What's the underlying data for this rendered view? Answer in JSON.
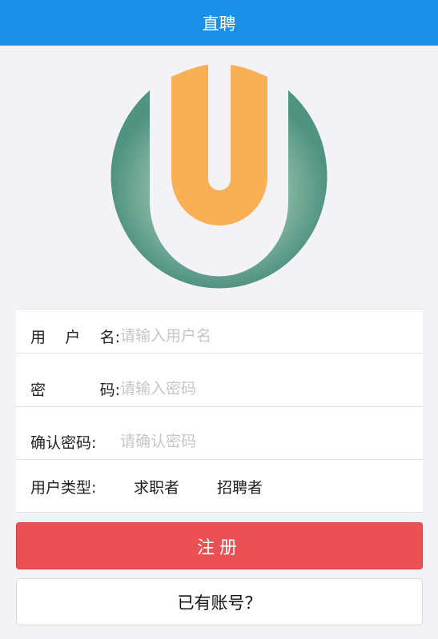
{
  "header": {
    "title": "直聘"
  },
  "logo": {
    "name": "u-logo",
    "colors": {
      "ring": "#5a9c8a",
      "u": "#f9b055"
    }
  },
  "form": {
    "username": {
      "label_chars": [
        "用",
        "户",
        "名"
      ],
      "colon": ":",
      "placeholder": "请输入用户名",
      "value": ""
    },
    "password": {
      "label_chars": [
        "密",
        "码"
      ],
      "colon": ":",
      "placeholder": "请输入密码",
      "value": ""
    },
    "confirm": {
      "label": "确认密码",
      "colon": ":",
      "placeholder": "请确认密码",
      "value": ""
    },
    "user_type": {
      "label": "用户类型",
      "colon": ":",
      "options": [
        "求职者",
        "招聘者"
      ]
    }
  },
  "buttons": {
    "register": "注册",
    "have_account": "已有账号？"
  },
  "colors": {
    "header_bg": "#1a8fe8",
    "register_bg": "#ea5054",
    "page_bg": "#f3f2f7"
  }
}
